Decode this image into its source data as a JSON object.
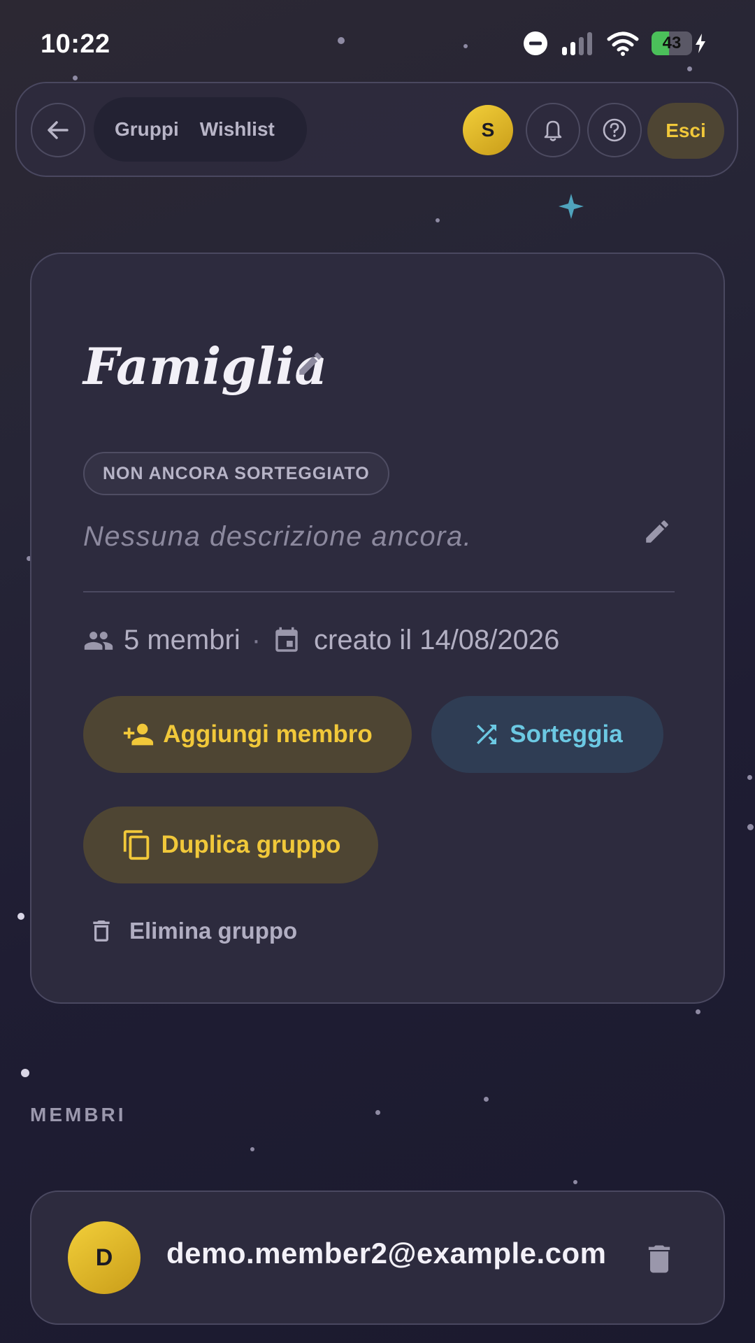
{
  "status_bar": {
    "time": "10:22",
    "battery": "43",
    "battery_level": 0.43
  },
  "nav": {
    "tabs": [
      "Gruppi",
      "Wishlist"
    ],
    "avatar_initial": "S",
    "logout_label": "Esci",
    "icons": {
      "back": "arrow-left-icon",
      "notifications": "bell-icon",
      "help": "help-circle-icon"
    }
  },
  "group": {
    "title": "Famiglia",
    "status": "NON ANCORA SORTEGGIATO",
    "description_placeholder": "Nessuna descrizione ancora.",
    "members_count": "5 membri",
    "created": "creato il 14/08/2026",
    "add_member_label": "Aggiungi membro",
    "draw_label": "Sorteggia",
    "duplicate_label": "Duplica gruppo",
    "delete_label": "Elimina gruppo"
  },
  "members_section": {
    "title": "MEMBRI",
    "members": [
      {
        "initial": "D",
        "email": "demo.member2@example.com"
      }
    ]
  },
  "colors": {
    "accent_gold": "#f1c83a",
    "accent_cyan": "#6cc9e3",
    "card_bg": "#2d2b3e",
    "page_bg": "#1f1d33"
  }
}
